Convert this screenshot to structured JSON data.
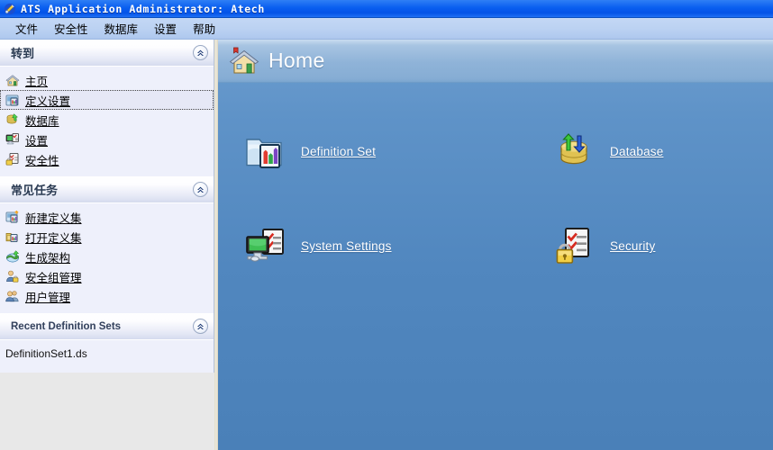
{
  "window": {
    "title": "ATS Application Administrator: Atech",
    "icon": "app-wrench-icon"
  },
  "menubar": {
    "items": [
      {
        "label": "文件",
        "name": "menu-file"
      },
      {
        "label": "安全性",
        "name": "menu-security"
      },
      {
        "label": "数据库",
        "name": "menu-database"
      },
      {
        "label": "设置",
        "name": "menu-settings"
      },
      {
        "label": "帮助",
        "name": "menu-help"
      }
    ]
  },
  "sidebar": {
    "panels": [
      {
        "title": "转到",
        "collapse_icon": "double-chevron-up-icon",
        "items": [
          {
            "label": "主页",
            "icon": "home-small-icon",
            "focused": false
          },
          {
            "label": "定义设置",
            "icon": "definition-set-small-icon",
            "focused": true
          },
          {
            "label": "数据库",
            "icon": "database-small-icon",
            "focused": false
          },
          {
            "label": "设置",
            "icon": "settings-small-icon",
            "focused": false
          },
          {
            "label": "安全性",
            "icon": "security-small-icon",
            "focused": false
          }
        ]
      },
      {
        "title": "常见任务",
        "collapse_icon": "double-chevron-up-icon",
        "items": [
          {
            "label": "新建定义集",
            "icon": "new-definition-set-icon",
            "focused": false
          },
          {
            "label": "打开定义集",
            "icon": "open-definition-set-icon",
            "focused": false
          },
          {
            "label": "生成架构",
            "icon": "generate-schema-icon",
            "focused": false
          },
          {
            "label": "安全组管理",
            "icon": "security-group-icon",
            "focused": false
          },
          {
            "label": "用户管理",
            "icon": "user-management-icon",
            "focused": false
          }
        ]
      },
      {
        "title": "Recent Definition Sets",
        "collapse_icon": "double-chevron-up-icon",
        "files": [
          {
            "label": "DefinitionSet1.ds"
          }
        ]
      }
    ]
  },
  "content": {
    "header": {
      "title": "Home",
      "icon": "home-large-icon"
    },
    "tiles": [
      {
        "label": "Definition Set",
        "icon": "definition-set-icon",
        "name": "tile-definition-set"
      },
      {
        "label": "Database",
        "icon": "database-icon",
        "name": "tile-database"
      },
      {
        "label": "System Settings",
        "icon": "system-settings-icon",
        "name": "tile-system-settings"
      },
      {
        "label": "Security",
        "icon": "security-icon",
        "name": "tile-security"
      }
    ]
  },
  "colors": {
    "titlebar_blue": "#0a5ff0",
    "menubar_blue": "#bcd2f2",
    "content_blue": "#5187bf",
    "content_header_blue": "#8fb3d8",
    "panel_bg": "#eef0fb",
    "link_white": "#ffffff"
  }
}
